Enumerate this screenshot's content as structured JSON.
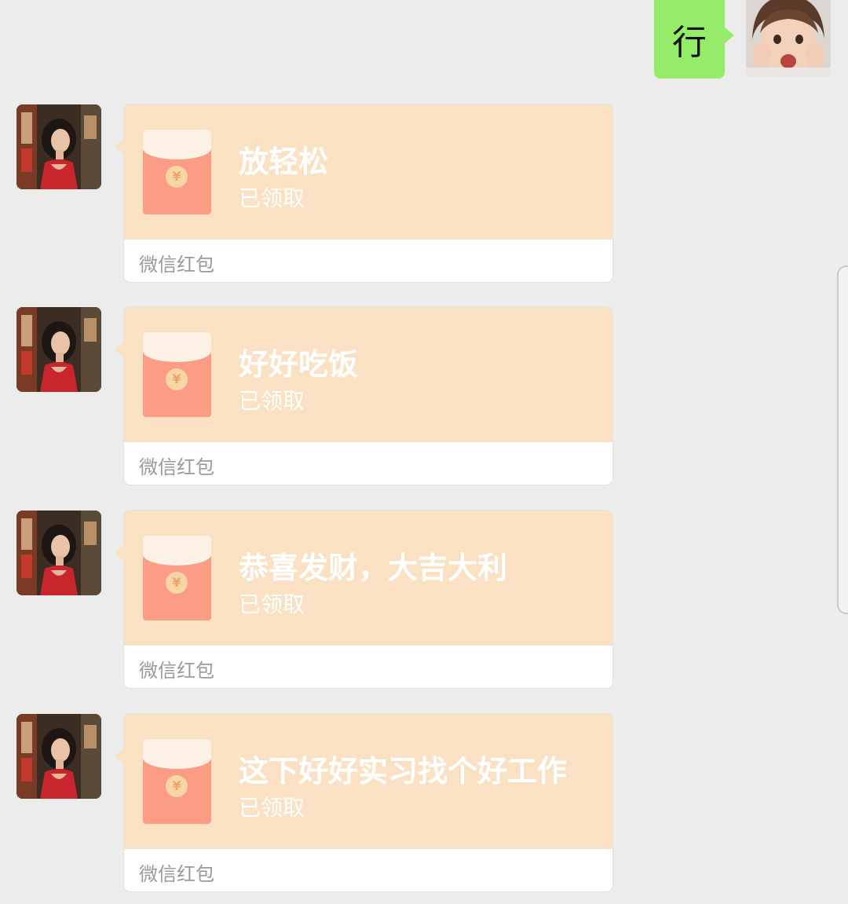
{
  "outgoing_message": {
    "text": "行",
    "avatar_icon": "child-avatar"
  },
  "red_packets": [
    {
      "greeting": "放轻松",
      "status": "已领取",
      "footer": "微信红包",
      "coin": "¥"
    },
    {
      "greeting": "好好吃饭",
      "status": "已领取",
      "footer": "微信红包",
      "coin": "¥"
    },
    {
      "greeting": "恭喜发财，大吉大利",
      "status": "已领取",
      "footer": "微信红包",
      "coin": "¥"
    },
    {
      "greeting": "这下好好实习找个好工作",
      "status": "已领取",
      "footer": "微信红包",
      "coin": "¥"
    }
  ],
  "colors": {
    "background": "#ececec",
    "outgoing_bubble": "#95ec69",
    "packet_top": "#fae1c3",
    "envelope": "#fa9d84",
    "footer_text": "#9a9a9a"
  }
}
